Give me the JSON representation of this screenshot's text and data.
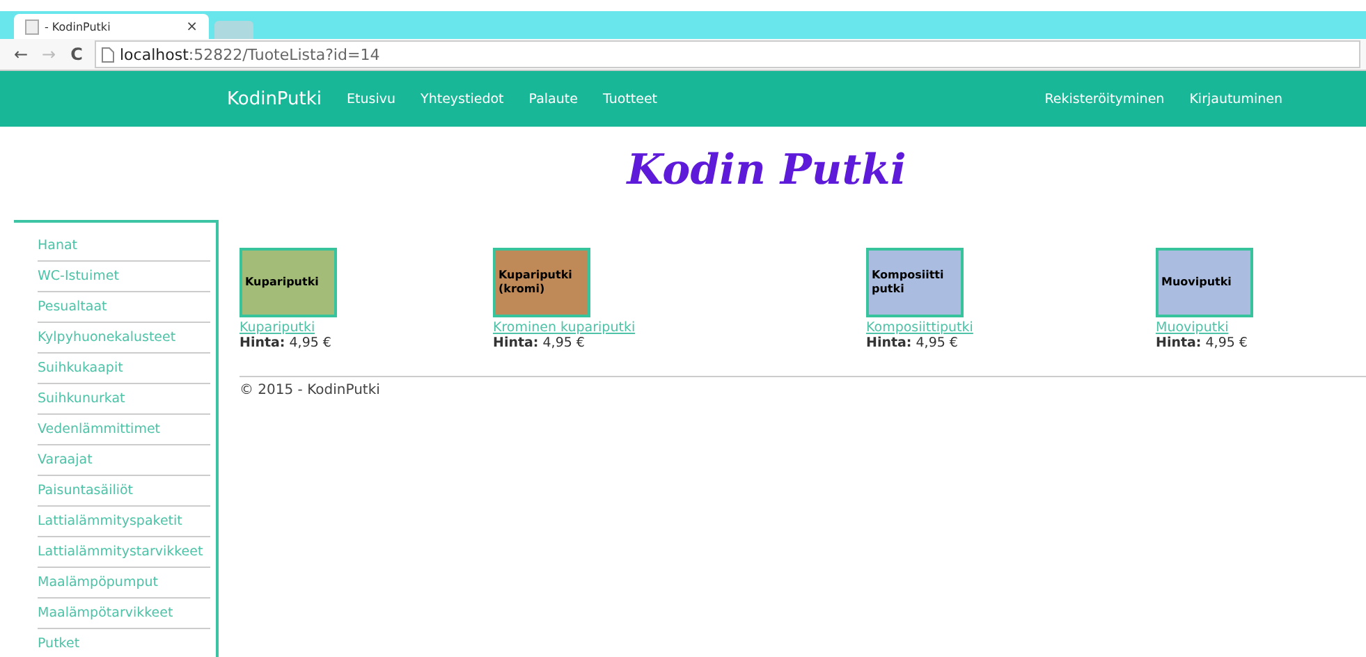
{
  "browser": {
    "tab_title": "- KodinPutki",
    "tab_close": "×",
    "url_host": "localhost",
    "url_rest": ":52822/TuoteLista?id=14",
    "back": "←",
    "forward": "→",
    "reload": "C"
  },
  "navbar": {
    "brand": "KodinPutki",
    "links": [
      "Etusivu",
      "Yhteystiedot",
      "Palaute",
      "Tuotteet"
    ],
    "right_links": [
      "Rekisteröityminen",
      "Kirjautuminen"
    ]
  },
  "page_title": "Kodin Putki",
  "sidebar": {
    "items": [
      "Hanat",
      "WC-Istuimet",
      "Pesualtaat",
      "Kylpyhuonekalusteet",
      "Suihkukaapit",
      "Suihkunurkat",
      "Vedenlämmittimet",
      "Varaajat",
      "Paisuntasäiliöt",
      "Lattialämmityspaketit",
      "Lattialämmitystarvikkeet",
      "Maalämpöpumput",
      "Maalämpötarvikkeet",
      "Putket"
    ]
  },
  "products": [
    {
      "image_text": "Kupariputki",
      "color": "#a3bd78",
      "name": "Kupariputki",
      "price": "**Hinta:** 4,95 €"
    },
    {
      "image_text": "Kupariputki (kromi)",
      "color": "#c08a58",
      "name": "Krominen kupariputki",
      "price": "**Hinta:** 4,95 €"
    },
    {
      "image_text": "Komposiitti putki",
      "color": "#aabde0",
      "name": "Komposiittiputki",
      "price": "**Hinta:** 4,95 €"
    },
    {
      "image_text": "Muoviputki",
      "color": "#aabde0",
      "name": "Muoviputki",
      "price": "**Hinta:** 4,95 €"
    }
  ],
  "footer": "© 2015 - KodinPutki"
}
